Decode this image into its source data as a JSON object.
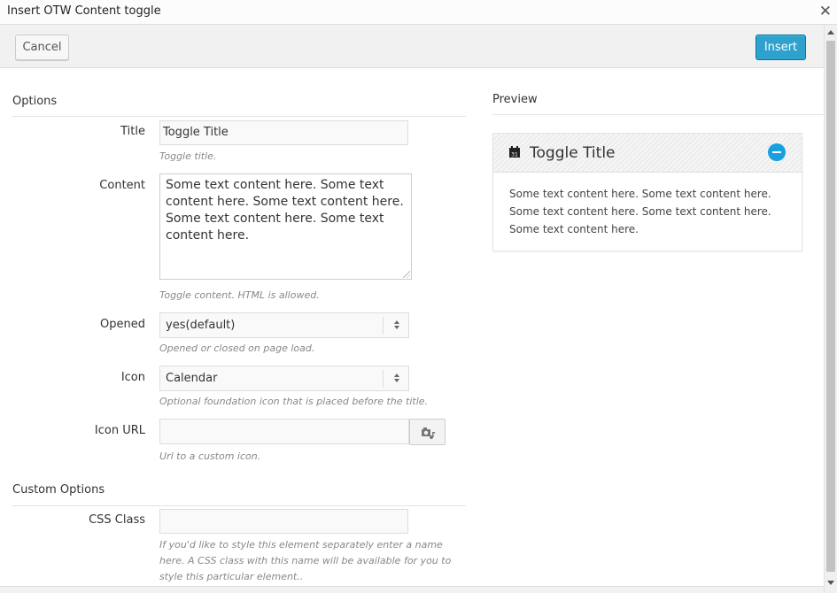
{
  "dialog": {
    "title": "Insert OTW Content toggle",
    "close_glyph": "✕"
  },
  "toolbar": {
    "cancel_label": "Cancel",
    "insert_label": "Insert"
  },
  "options": {
    "heading": "Options",
    "title": {
      "label": "Title",
      "value": "Toggle Title",
      "help": "Toggle title."
    },
    "content": {
      "label": "Content",
      "value": "Some text content here. Some text content here. Some text content here. Some text content here. Some text content here.",
      "help": "Toggle content. HTML is allowed."
    },
    "opened": {
      "label": "Opened",
      "value": "yes(default)",
      "help": "Opened or closed on page load."
    },
    "icon": {
      "label": "Icon",
      "value": "Calendar",
      "help": "Optional foundation icon that is placed before the title."
    },
    "icon_url": {
      "label": "Icon URL",
      "value": "",
      "help": "Url to a custom icon."
    }
  },
  "custom_options": {
    "heading": "Custom Options",
    "css_class": {
      "label": "CSS Class",
      "value": "",
      "help": "If you'd like to style this element separately enter a name here. A CSS class with this name will be available for you to style this particular element.."
    }
  },
  "preview": {
    "heading": "Preview",
    "toggle_title": "Toggle Title",
    "toggle_content": "Some text content here. Some text content here. Some text content here. Some text content here. Some text content here.",
    "calendar_day": "31",
    "accent_color": "#19a0e0"
  },
  "icons": {
    "media": "camera-music-icon",
    "preview_icon": "calendar-icon",
    "collapse": "minus-circle-icon"
  }
}
